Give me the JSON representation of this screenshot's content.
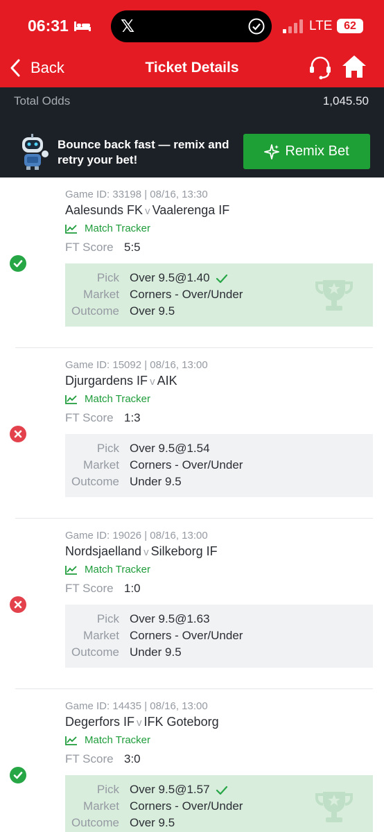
{
  "status_bar": {
    "time": "06:31",
    "network": "LTE",
    "battery": "62",
    "pill_app": "𝕏"
  },
  "header": {
    "back_label": "Back",
    "title": "Ticket Details"
  },
  "summary": {
    "total_odds_label": "Total Odds",
    "total_odds_value": "1,045.50"
  },
  "remix": {
    "message": "Bounce back fast — remix and retry your bet!",
    "button_label": "Remix Bet"
  },
  "labels": {
    "match_tracker": "Match Tracker",
    "ft_score": "FT Score",
    "pick": "Pick",
    "market": "Market",
    "outcome": "Outcome",
    "vs": "v"
  },
  "tickets": [
    {
      "meta": "Game ID: 33198 | 08/16, 13:30",
      "home": "Aalesunds FK",
      "away": "Vaalerenga IF",
      "score": "5:5",
      "result": "win",
      "pick": "Over 9.5@1.40",
      "market": "Corners - Over/Under",
      "outcome": "Over 9.5"
    },
    {
      "meta": "Game ID: 15092 | 08/16, 13:00",
      "home": "Djurgardens IF",
      "away": "AIK",
      "score": "1:3",
      "result": "lose",
      "pick": "Over 9.5@1.54",
      "market": "Corners - Over/Under",
      "outcome": "Under 9.5"
    },
    {
      "meta": "Game ID: 19026 | 08/16, 13:00",
      "home": "Nordsjaelland",
      "away": "Silkeborg IF",
      "score": "1:0",
      "result": "lose",
      "pick": "Over 9.5@1.63",
      "market": "Corners - Over/Under",
      "outcome": "Under 9.5"
    },
    {
      "meta": "Game ID: 14435 | 08/16, 13:00",
      "home": "Degerfors IF",
      "away": "IFK Goteborg",
      "score": "3:0",
      "result": "win",
      "pick": "Over 9.5@1.57",
      "market": "Corners - Over/Under",
      "outcome": "Over 9.5"
    }
  ],
  "colors": {
    "brand_red": "#e41b23",
    "win_green": "#27a646",
    "lose_red": "#e3414b",
    "remix_green": "#1fa036",
    "dark_band": "#1c2027"
  }
}
